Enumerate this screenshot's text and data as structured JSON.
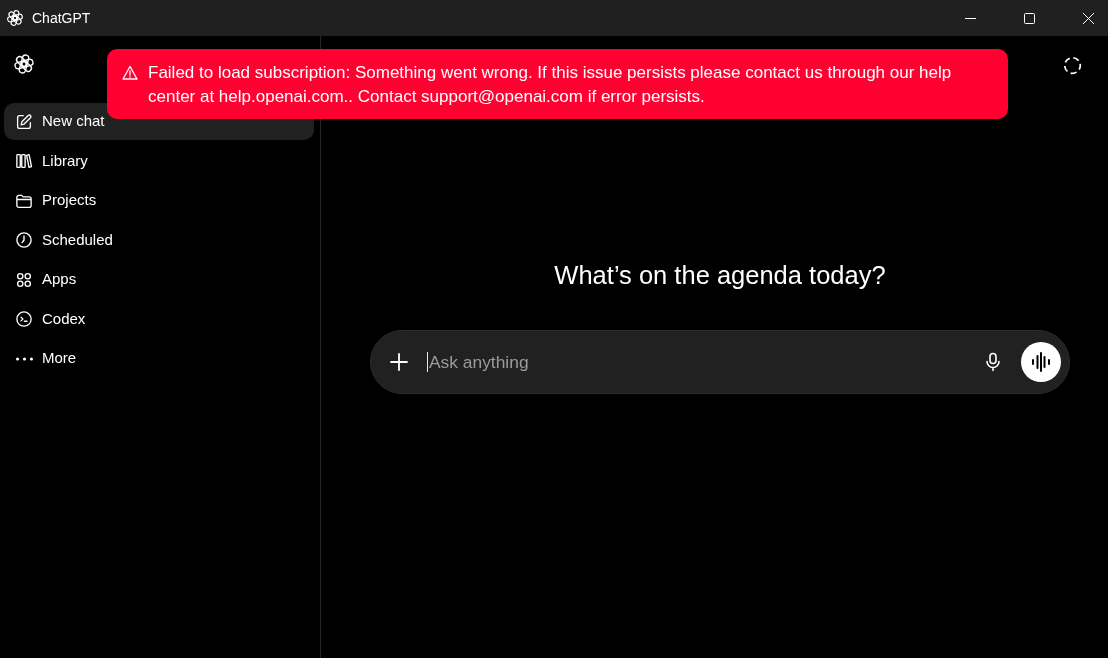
{
  "window": {
    "title": "ChatGPT"
  },
  "sidebar": {
    "items": [
      {
        "label": "New chat",
        "selected": true
      },
      {
        "label": "Library",
        "selected": false
      },
      {
        "label": "Projects",
        "selected": false
      },
      {
        "label": "Scheduled",
        "selected": false
      },
      {
        "label": "Apps",
        "selected": false
      },
      {
        "label": "Codex",
        "selected": false
      },
      {
        "label": "More",
        "selected": false
      }
    ]
  },
  "alert": {
    "message": "Failed to load subscription: Something went wrong. If this issue persists please contact us through our help center at help.openai.com.. Contact support@openai.com if error persists."
  },
  "main": {
    "heading": "What’s on the agenda today?",
    "composer": {
      "placeholder": "Ask anything"
    }
  }
}
